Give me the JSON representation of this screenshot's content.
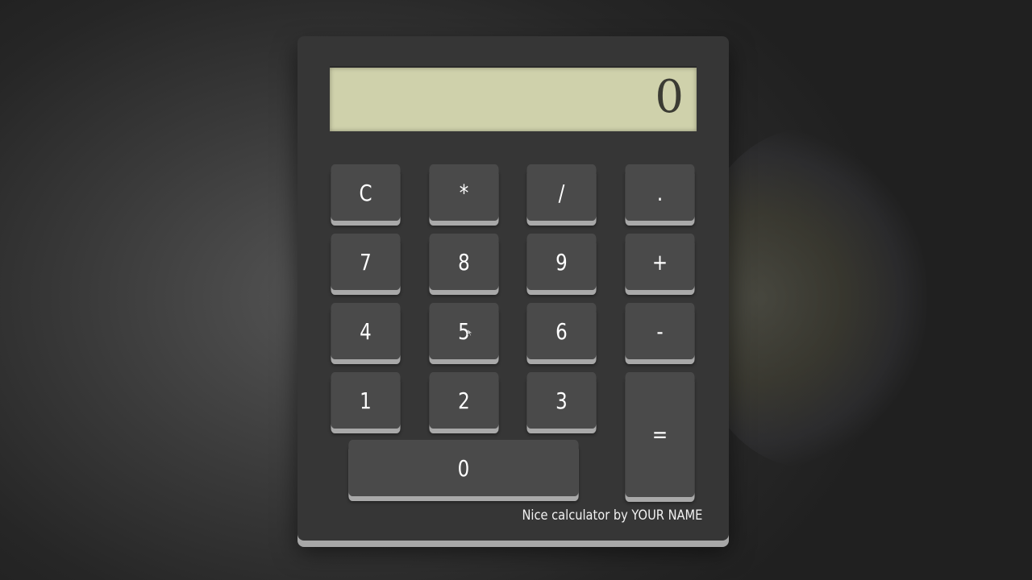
{
  "display": {
    "value": "0"
  },
  "keys": [
    {
      "label": "C"
    },
    {
      "label": "*"
    },
    {
      "label": "/"
    },
    {
      "label": "."
    },
    {
      "label": "7"
    },
    {
      "label": "8"
    },
    {
      "label": "9"
    },
    {
      "label": "+"
    },
    {
      "label": "4"
    },
    {
      "label": "5"
    },
    {
      "label": "6"
    },
    {
      "label": "-"
    },
    {
      "label": "1"
    },
    {
      "label": "2"
    },
    {
      "label": "3"
    },
    {
      "label": "="
    },
    {
      "label": "0"
    }
  ],
  "footer": {
    "credit": "Nice calculator by YOUR NAME"
  },
  "colors": {
    "body": "#363636",
    "key": "#4a4a4a",
    "key_edge": "#a9a9a9",
    "display_bg": "#cfd1ab",
    "display_text": "#3b3b33"
  }
}
